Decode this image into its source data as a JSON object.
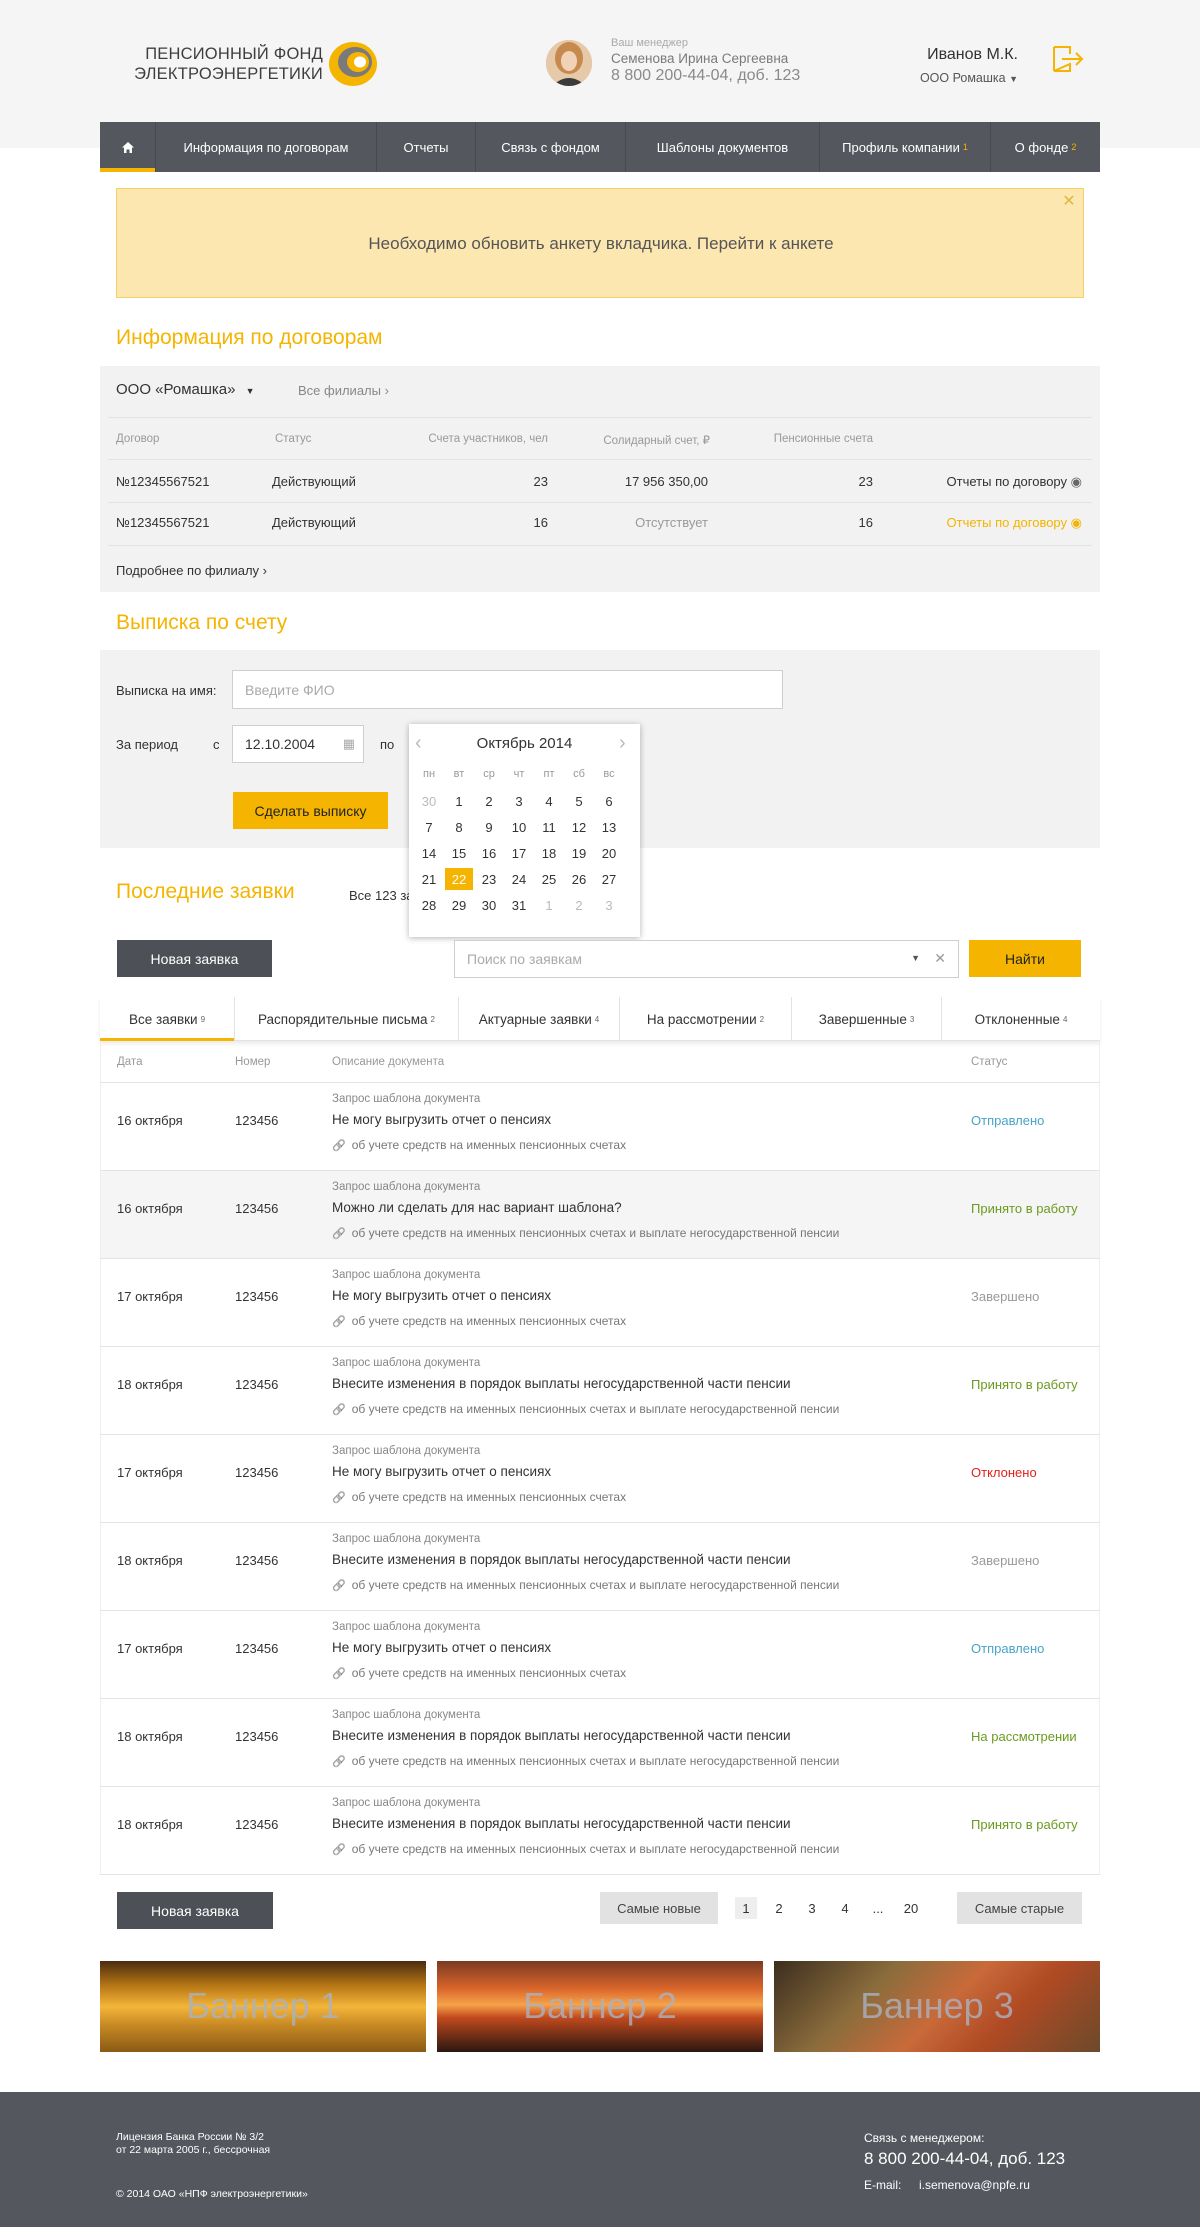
{
  "header": {
    "logo_text": "ПЕНСИОННЫЙ ФОНД ЭЛЕКТРОЭНЕРГЕТИКИ",
    "manager_caption": "Ваш менеджер",
    "manager_name": "Семенова Ирина Сергеевна",
    "manager_phone": "8 800 200-44-04, доб. 123",
    "user_name": "Иванов М.К.",
    "user_org": "ООО Ромашка"
  },
  "nav": {
    "items": [
      {
        "label": "Информация по договорам"
      },
      {
        "label": "Отчеты"
      },
      {
        "label": "Связь с фондом"
      },
      {
        "label": "Шаблоны документов"
      },
      {
        "label": "Профиль компании",
        "badge": "1"
      },
      {
        "label": "О фонде",
        "badge": "2"
      }
    ]
  },
  "alert": {
    "text": "Необходимо обновить анкету вкладчика. Перейти к анкете"
  },
  "contracts": {
    "title": "Информация по договорам",
    "org": "ООО «Ромашка»",
    "all_branches": "Все филиалы",
    "columns": [
      "Договор",
      "Статус",
      "Счета участников, чел",
      "Солидарный счет, ₽",
      "Пенсионные счета"
    ],
    "rows": [
      {
        "number": "№12345567521",
        "status": "Действующий",
        "participants": "23",
        "solidary": "17 956 350,00",
        "pension": "23",
        "link": "Отчеты по договору"
      },
      {
        "number": "№12345567521",
        "status": "Действующий",
        "participants": "16",
        "solidary": "Отсутствует",
        "pension": "16",
        "link": "Отчеты по договору"
      }
    ],
    "more": "Подробнее по филиалу"
  },
  "statement": {
    "title": "Выписка по счету",
    "name_label": "Выписка на имя:",
    "name_placeholder": "Введите ФИО",
    "period_label": "За период",
    "from_label": "с",
    "from_value": "12.10.2004",
    "to_label": "по",
    "submit": "Сделать выписку"
  },
  "calendar": {
    "title": "Октябрь 2014",
    "weekdays": [
      "пн",
      "вт",
      "ср",
      "чт",
      "пт",
      "сб",
      "вс"
    ],
    "weeks": [
      [
        "30",
        "1",
        "2",
        "3",
        "4",
        "5",
        "6"
      ],
      [
        "7",
        "8",
        "9",
        "10",
        "11",
        "12",
        "13"
      ],
      [
        "14",
        "15",
        "16",
        "17",
        "18",
        "19",
        "20"
      ],
      [
        "21",
        "22",
        "23",
        "24",
        "25",
        "26",
        "27"
      ],
      [
        "28",
        "29",
        "30",
        "31",
        "1",
        "2",
        "3"
      ]
    ],
    "selected": "22"
  },
  "requests": {
    "title": "Последние заявки",
    "all_link": "Все 123 за",
    "new_button": "Новая заявка",
    "search_placeholder": "Поиск по заявкам",
    "find_button": "Найти",
    "tabs": [
      {
        "label": "Все заявки",
        "count": "9"
      },
      {
        "label": "Распорядительные письма",
        "count": "2"
      },
      {
        "label": "Актуарные заявки",
        "count": "4"
      },
      {
        "label": "На рассмотрении",
        "count": "2"
      },
      {
        "label": "Завершенные",
        "count": "3"
      },
      {
        "label": "Отклоненные",
        "count": "4"
      }
    ],
    "columns": [
      "Дата",
      "Номер",
      "Описание документа",
      "Статус"
    ],
    "rows": [
      {
        "date": "16 октября",
        "num": "123456",
        "caption": "Запрос шаблона документа",
        "desc": "Не могу выгрузить отчет о пенсиях",
        "att": "об учете средств на именных пенсионных счетах",
        "status": "Отправлено"
      },
      {
        "date": "16 октября",
        "num": "123456",
        "caption": "Запрос шаблона документа",
        "desc": "Можно ли сделать для нас вариант шаблона?",
        "att": "об учете средств на именных пенсионных счетах и выплате негосударственной пенсии",
        "status": "Принято в работу"
      },
      {
        "date": "17 октября",
        "num": "123456",
        "caption": "Запрос шаблона документа",
        "desc": "Не могу выгрузить отчет о пенсиях",
        "att": "об учете средств на именных пенсионных счетах",
        "status": "Завершено"
      },
      {
        "date": "18 октября",
        "num": "123456",
        "caption": "Запрос шаблона документа",
        "desc": "Внесите изменения в порядок выплаты негосударственной части пенсии",
        "att": "об учете средств на именных пенсионных счетах и выплате негосударственной пенсии",
        "status": "Принято в работу"
      },
      {
        "date": "17 октября",
        "num": "123456",
        "caption": "Запрос шаблона документа",
        "desc": "Не могу выгрузить отчет о пенсиях",
        "att": "об учете средств на именных пенсионных счетах",
        "status": "Отклонено"
      },
      {
        "date": "18 октября",
        "num": "123456",
        "caption": "Запрос шаблона документа",
        "desc": "Внесите изменения в порядок выплаты негосударственной части пенсии",
        "att": "об учете средств на именных пенсионных счетах и выплате негосударственной пенсии",
        "status": "Завершено"
      },
      {
        "date": "17 октября",
        "num": "123456",
        "caption": "Запрос шаблона документа",
        "desc": "Не могу выгрузить отчет о пенсиях",
        "att": "об учете средств на именных пенсионных счетах",
        "status": "Отправлено"
      },
      {
        "date": "18 октября",
        "num": "123456",
        "caption": "Запрос шаблона документа",
        "desc": "Внесите изменения в порядок выплаты негосударственной части пенсии",
        "att": "об учете средств на именных пенсионных счетах и выплате негосударственной пенсии",
        "status": "На рассмотрении"
      },
      {
        "date": "18 октября",
        "num": "123456",
        "caption": "Запрос шаблона документа",
        "desc": "Внесите изменения в порядок выплаты негосударственной части пенсии",
        "att": "об учете средств на именных пенсионных счетах и выплате негосударственной пенсии",
        "status": "Принято в работу"
      }
    ],
    "status_colors": {
      "Отправлено": "#4aa3c9",
      "Принято в работу": "#6a9a1f",
      "Завершено": "#999999",
      "Отклонено": "#e0201b",
      "На рассмотрении": "#6a9a1f"
    }
  },
  "pagination": {
    "newest": "Самые новые",
    "oldest": "Самые старые",
    "pages": [
      "1",
      "2",
      "3",
      "4",
      "...",
      "20"
    ],
    "current": "1"
  },
  "banners": [
    {
      "label": "Баннер 1"
    },
    {
      "label": "Баннер 2"
    },
    {
      "label": "Баннер 3"
    }
  ],
  "footer": {
    "license_line1": "Лицензия Банка России № 3/2",
    "license_line2": "от 22 марта 2005 г., бессрочная",
    "copyright": "© 2014 ОАО «НПФ электроэнергетики»",
    "contact_label": "Связь с менеджером:",
    "phone": "8 800 200-44-04, доб. 123",
    "email_label": "E-mail:",
    "email": "i.semenova@npfe.ru"
  },
  "colors": {
    "accent": "#f5b400",
    "dark": "#54575d",
    "alert_bg": "#fde7b1"
  }
}
